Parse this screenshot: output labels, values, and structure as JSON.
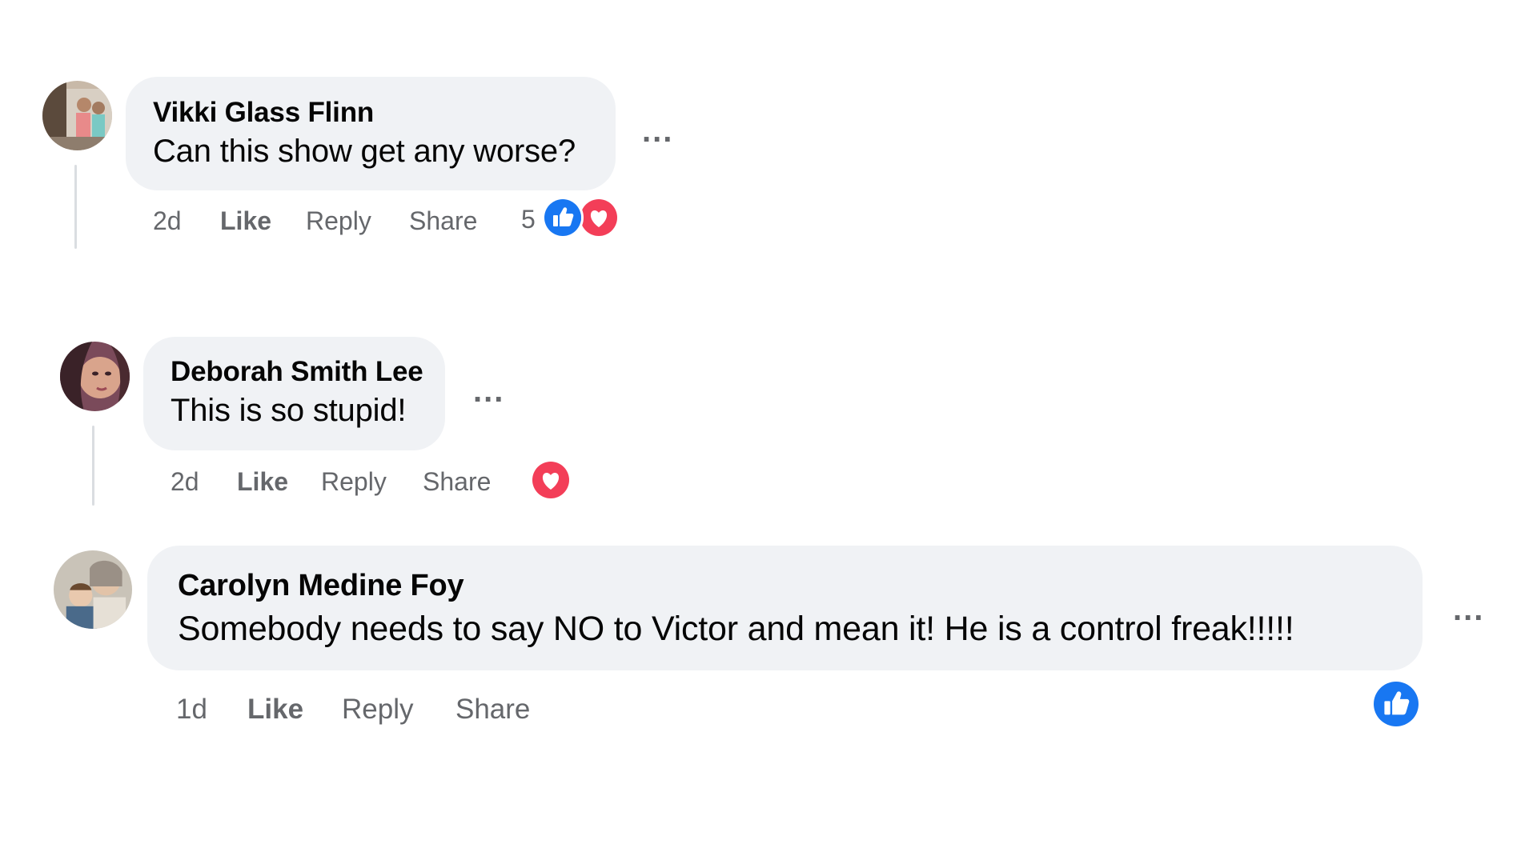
{
  "comments": [
    {
      "author": "Vikki Glass Flinn",
      "text": "Can this show get any worse?",
      "time": "2d",
      "actions": {
        "like": "Like",
        "reply": "Reply",
        "share": "Share"
      },
      "reaction_count": "5",
      "reactions": [
        "like-icon",
        "love-icon"
      ]
    },
    {
      "author": "Deborah Smith Lee",
      "text": "This is so stupid!",
      "time": "2d",
      "actions": {
        "like": "Like",
        "reply": "Reply",
        "share": "Share"
      },
      "reactions": [
        "love-icon"
      ]
    },
    {
      "author": "Carolyn Medine Foy",
      "text": "Somebody needs to say NO to Victor and mean it! He is a control freak!!!!!",
      "time": "1d",
      "actions": {
        "like": "Like",
        "reply": "Reply",
        "share": "Share"
      },
      "reactions": [
        "like-icon"
      ]
    }
  ],
  "more_glyph": "...",
  "colors": {
    "bubble": "#f0f2f5",
    "secondary_text": "#65676b",
    "like_blue": "#1877f2",
    "love_red": "#f33e58"
  }
}
